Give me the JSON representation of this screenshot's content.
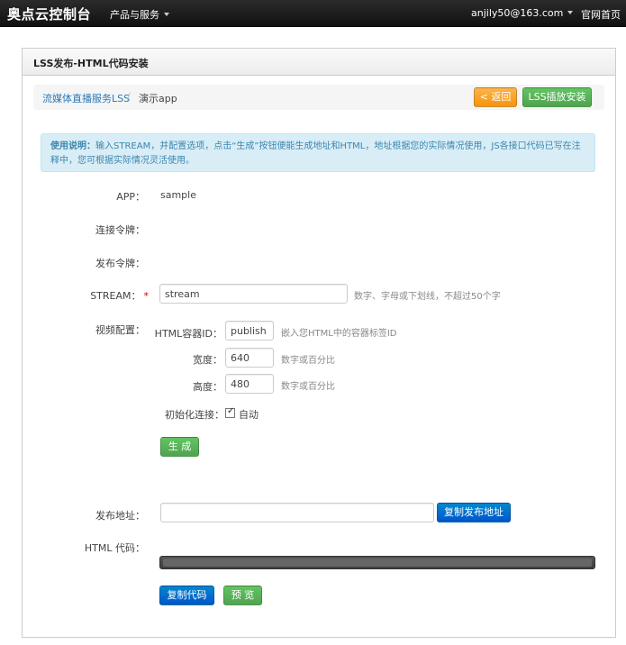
{
  "topbar": {
    "brand": "奥点云控制台",
    "products_label": "产品与服务",
    "user_email": "anjily50@163.com",
    "home_label": "官网首页"
  },
  "panel": {
    "title": "LSS发布-HTML代码安装"
  },
  "breadcrumb": {
    "parent": "流媒体直播服务LSS",
    "separator": "/",
    "current": "演示app"
  },
  "actions": {
    "back_label": "< 返回",
    "install_label": "LSS插放安装"
  },
  "alert": {
    "title": "使用说明：",
    "text": "输入STREAM，并配置选项，点击“生成”按钮便能生成地址和HTML，地址根据您的实际情况使用，JS各接口代码已写在注释中，您可根据实际情况灵活使用。"
  },
  "form": {
    "app_label": "APP：",
    "app_value": "sample",
    "connect_token_label": "连接令牌：",
    "publish_token_label": "发布令牌：",
    "stream_label": "STREAM：",
    "stream_required": "*",
    "stream_value": "stream",
    "stream_hint": "数字、字母或下划线，不超过50个字",
    "video_config_label": "视频配置：",
    "container_label": "HTML容器ID：",
    "container_value": "publish",
    "container_hint": "嵌入您HTML中的容器标签ID",
    "width_label": "宽度：",
    "width_value": "640",
    "width_hint": "数字或百分比",
    "height_label": "高度：",
    "height_value": "480",
    "height_hint": "数字或百分比",
    "init_label": "初始化连接：",
    "auto_checked": true,
    "auto_label": "自动",
    "generate_label": "生 成",
    "publish_url_label": "发布地址：",
    "publish_url_value": "",
    "copy_url_label": "复制发布地址",
    "html_code_label": "HTML 代码：",
    "copy_code_label": "复制代码",
    "preview_label": "预 览"
  },
  "colors": {
    "orange": "#f89406",
    "green": "#51a351",
    "blue": "#0055cc",
    "alert_bg": "#d9edf7",
    "link": "#2a7ab8"
  }
}
